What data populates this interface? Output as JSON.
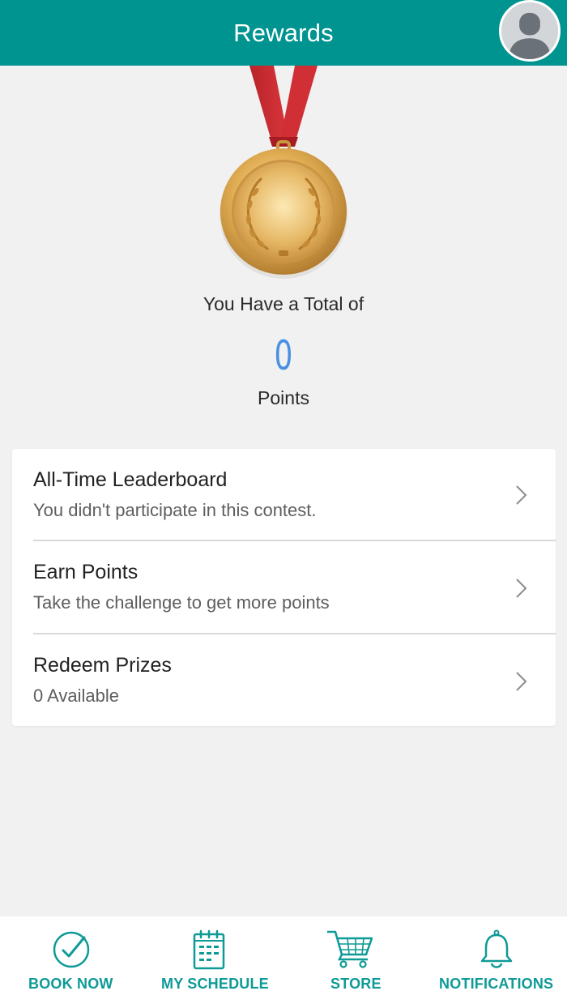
{
  "header": {
    "title": "Rewards"
  },
  "summary": {
    "total_label": "You Have a Total of",
    "points_value": "0",
    "points_label": "Points"
  },
  "menu": [
    {
      "title": "All-Time Leaderboard",
      "subtitle": "You didn't participate in this contest."
    },
    {
      "title": "Earn Points",
      "subtitle": "Take the challenge to get more points"
    },
    {
      "title": "Redeem Prizes",
      "subtitle": "0 Available"
    }
  ],
  "tabs": [
    {
      "label": "BOOK NOW",
      "icon": "check-circle-icon"
    },
    {
      "label": "MY SCHEDULE",
      "icon": "calendar-icon"
    },
    {
      "label": "STORE",
      "icon": "cart-icon"
    },
    {
      "label": "NOTIFICATIONS",
      "icon": "bell-icon"
    }
  ],
  "colors": {
    "header_bg": "#009490",
    "accent": "#0e9a96",
    "points": "#4a90e2",
    "ribbon": "#d32b30",
    "medal_gold": "#d9a548"
  }
}
